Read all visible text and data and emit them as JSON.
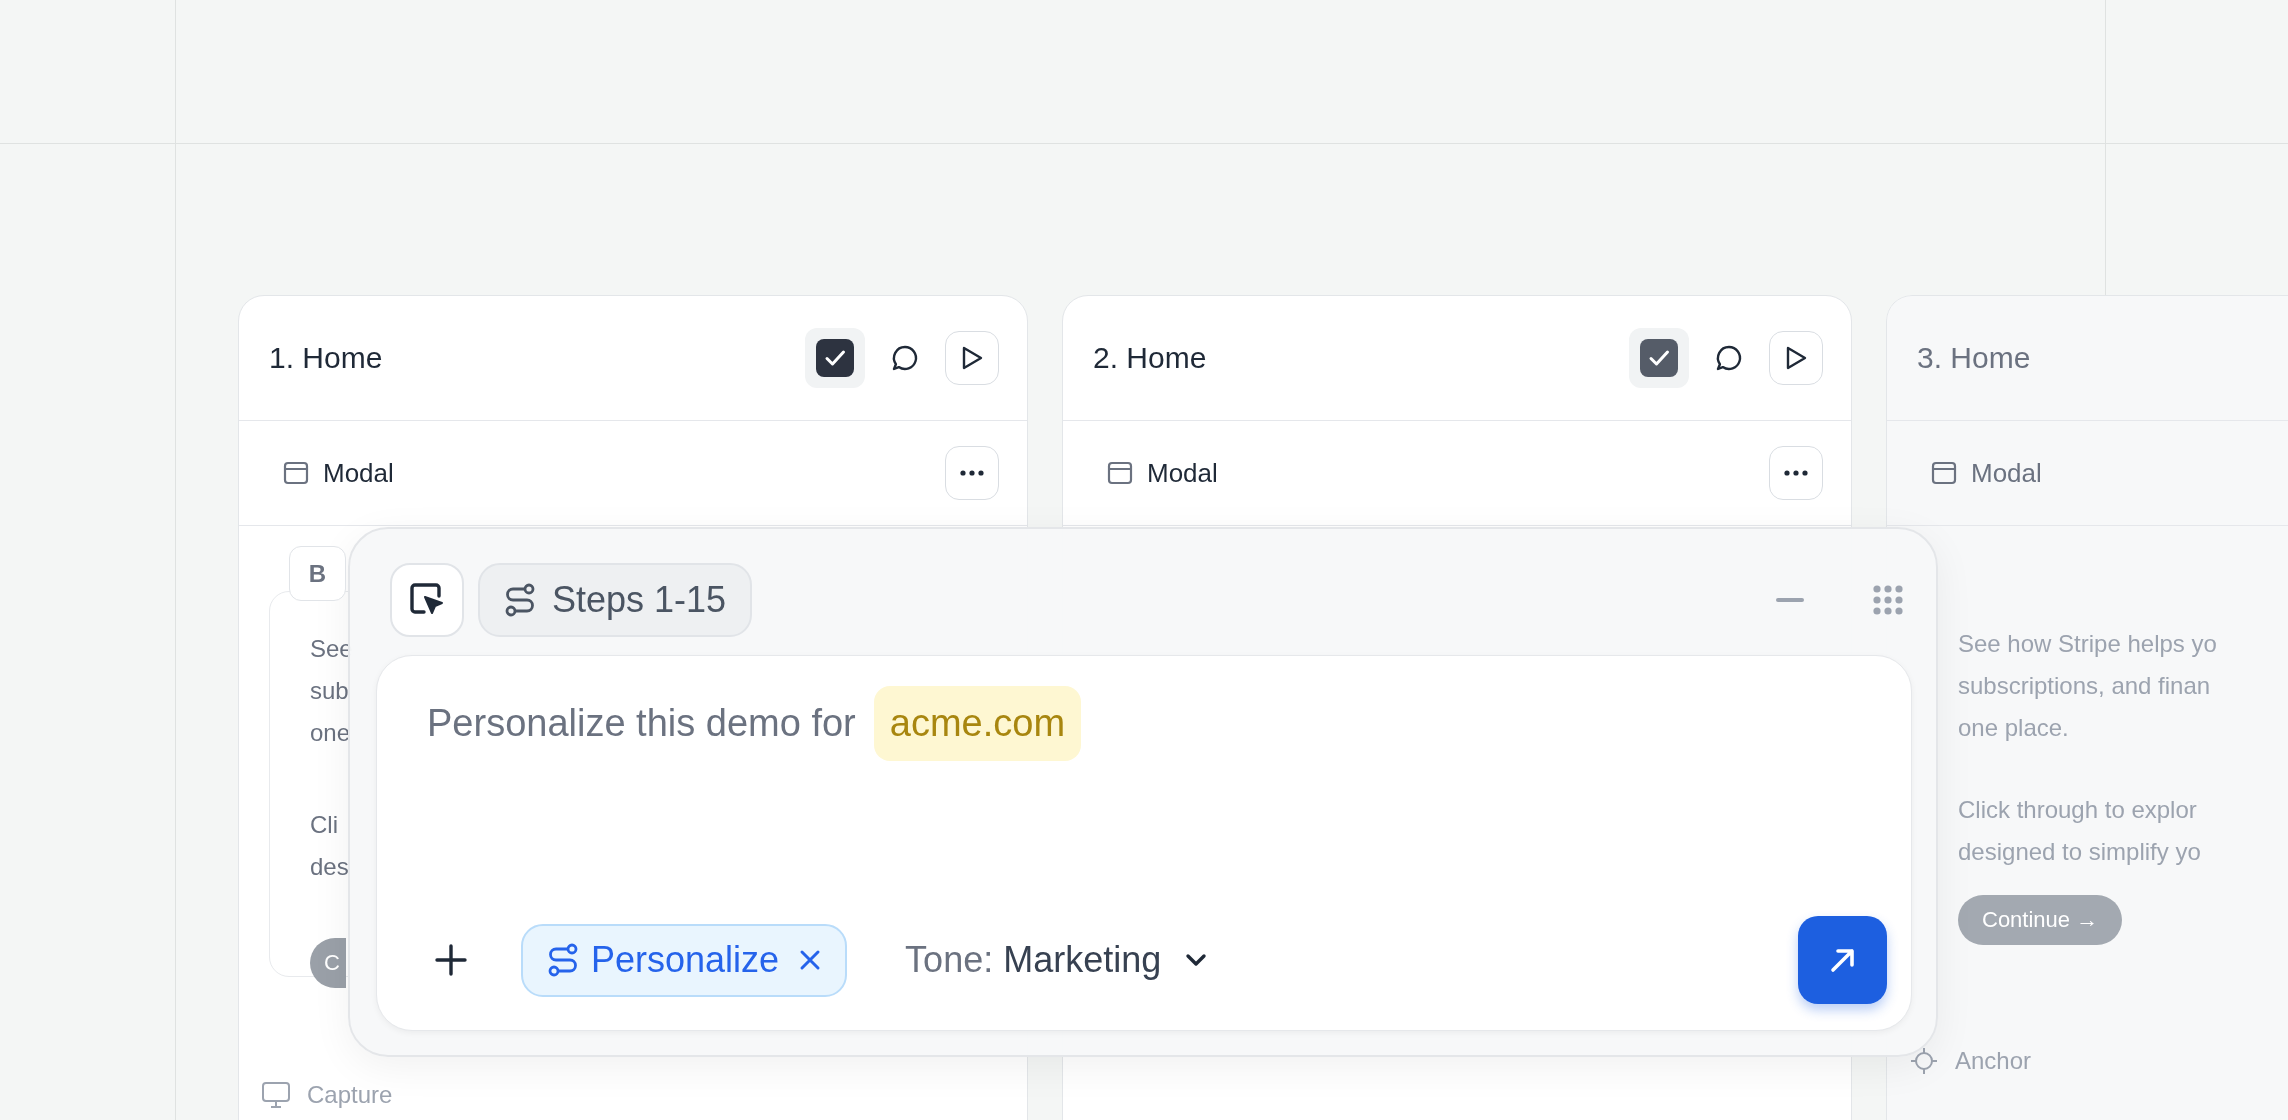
{
  "cards": [
    {
      "title": "1. Home",
      "checked": true,
      "section": "Modal",
      "toolbar": [
        "B"
      ],
      "paragraphs": [
        [
          "See",
          "sub",
          "one"
        ],
        [
          "Cli",
          "des"
        ]
      ],
      "continue": "C",
      "footer": {
        "kind": "capture",
        "label": "Capture"
      }
    },
    {
      "title": "2. Home",
      "checked": true,
      "section": "Modal"
    },
    {
      "title": "3. Home",
      "section": "Modal",
      "paragraphs": [
        [
          "See how Stripe helps yo",
          "subscriptions, and finan",
          "one place."
        ],
        [
          "Click through to explor",
          "designed to simplify yo"
        ]
      ],
      "continue": "Continue →",
      "footer": {
        "kind": "anchor",
        "label": "Anchor"
      }
    }
  ],
  "panel": {
    "steps": "Steps 1-15",
    "prompt": "Personalize this demo for",
    "domain": "acme.com",
    "chip": "Personalize",
    "tone_label": "Tone:",
    "tone_value": "Marketing"
  }
}
